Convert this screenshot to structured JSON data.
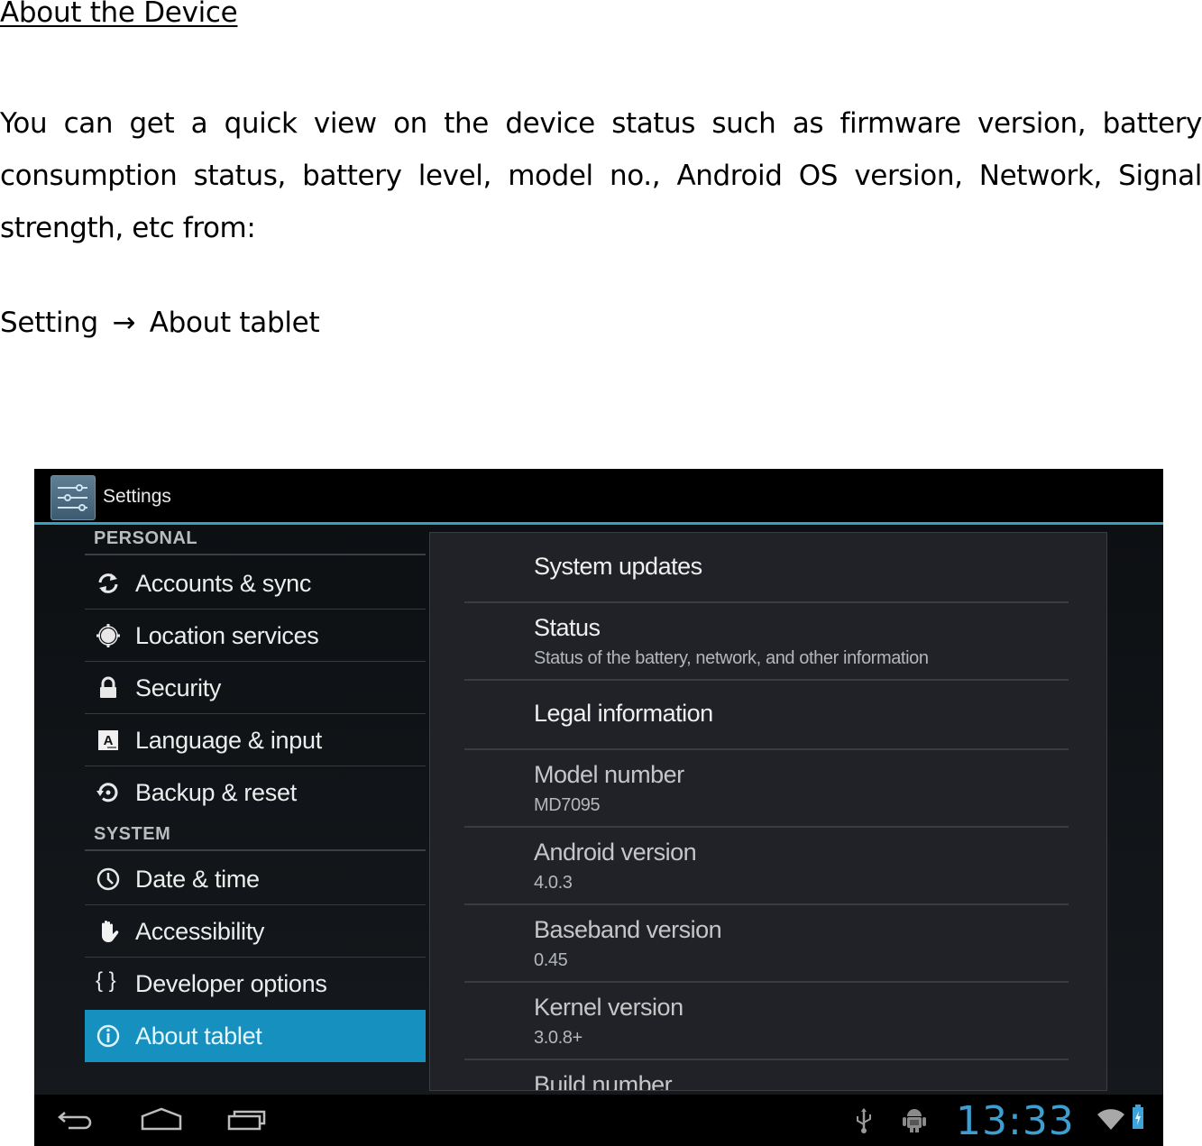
{
  "document": {
    "heading": "About the Device",
    "paragraph": "You can get a quick view on the device status such as firmware version, battery consumption status, battery level, model no., Android OS version, Network, Signal strength, etc from:",
    "path": {
      "from": "Setting",
      "arrow": "→",
      "to": "About tablet"
    }
  },
  "screenshot": {
    "actionbar": {
      "icon": "settings-sliders-icon",
      "title": "Settings"
    },
    "sidebar": {
      "sections": [
        {
          "header": "PERSONAL",
          "items": [
            {
              "label": "Accounts & sync",
              "icon": "sync-icon"
            },
            {
              "label": "Location services",
              "icon": "location-icon"
            },
            {
              "label": "Security",
              "icon": "lock-icon"
            },
            {
              "label": "Language & input",
              "icon": "keyboard-language-icon"
            },
            {
              "label": "Backup & reset",
              "icon": "backup-restore-icon"
            }
          ]
        },
        {
          "header": "SYSTEM",
          "items": [
            {
              "label": "Date & time",
              "icon": "clock-icon"
            },
            {
              "label": "Accessibility",
              "icon": "hand-icon"
            },
            {
              "label": "Developer options",
              "icon": "braces-icon",
              "glyph": "{ }"
            },
            {
              "label": "About tablet",
              "icon": "info-icon",
              "active": true
            }
          ]
        }
      ]
    },
    "about": {
      "items": [
        {
          "title": "System updates"
        },
        {
          "title": "Status",
          "summary": "Status of the battery, network, and other information"
        },
        {
          "title": "Legal information"
        },
        {
          "title": "Model number",
          "summary": "MD7095"
        },
        {
          "title": "Android version",
          "summary": "4.0.3"
        },
        {
          "title": "Baseband version",
          "summary": "0.45"
        },
        {
          "title": "Kernel version",
          "summary": "3.0.8+"
        },
        {
          "title": "Build number"
        }
      ]
    },
    "navbar": {
      "buttons": [
        "back-icon",
        "home-icon",
        "recent-apps-icon"
      ],
      "status_icons": [
        "usb-icon",
        "android-debug-icon",
        "wifi-icon",
        "battery-charging-icon"
      ],
      "clock": "13:33"
    },
    "colors": {
      "accent": "#1690bf",
      "clock": "#3c9fcf",
      "actionbar_line": "#3a9ec2"
    }
  }
}
